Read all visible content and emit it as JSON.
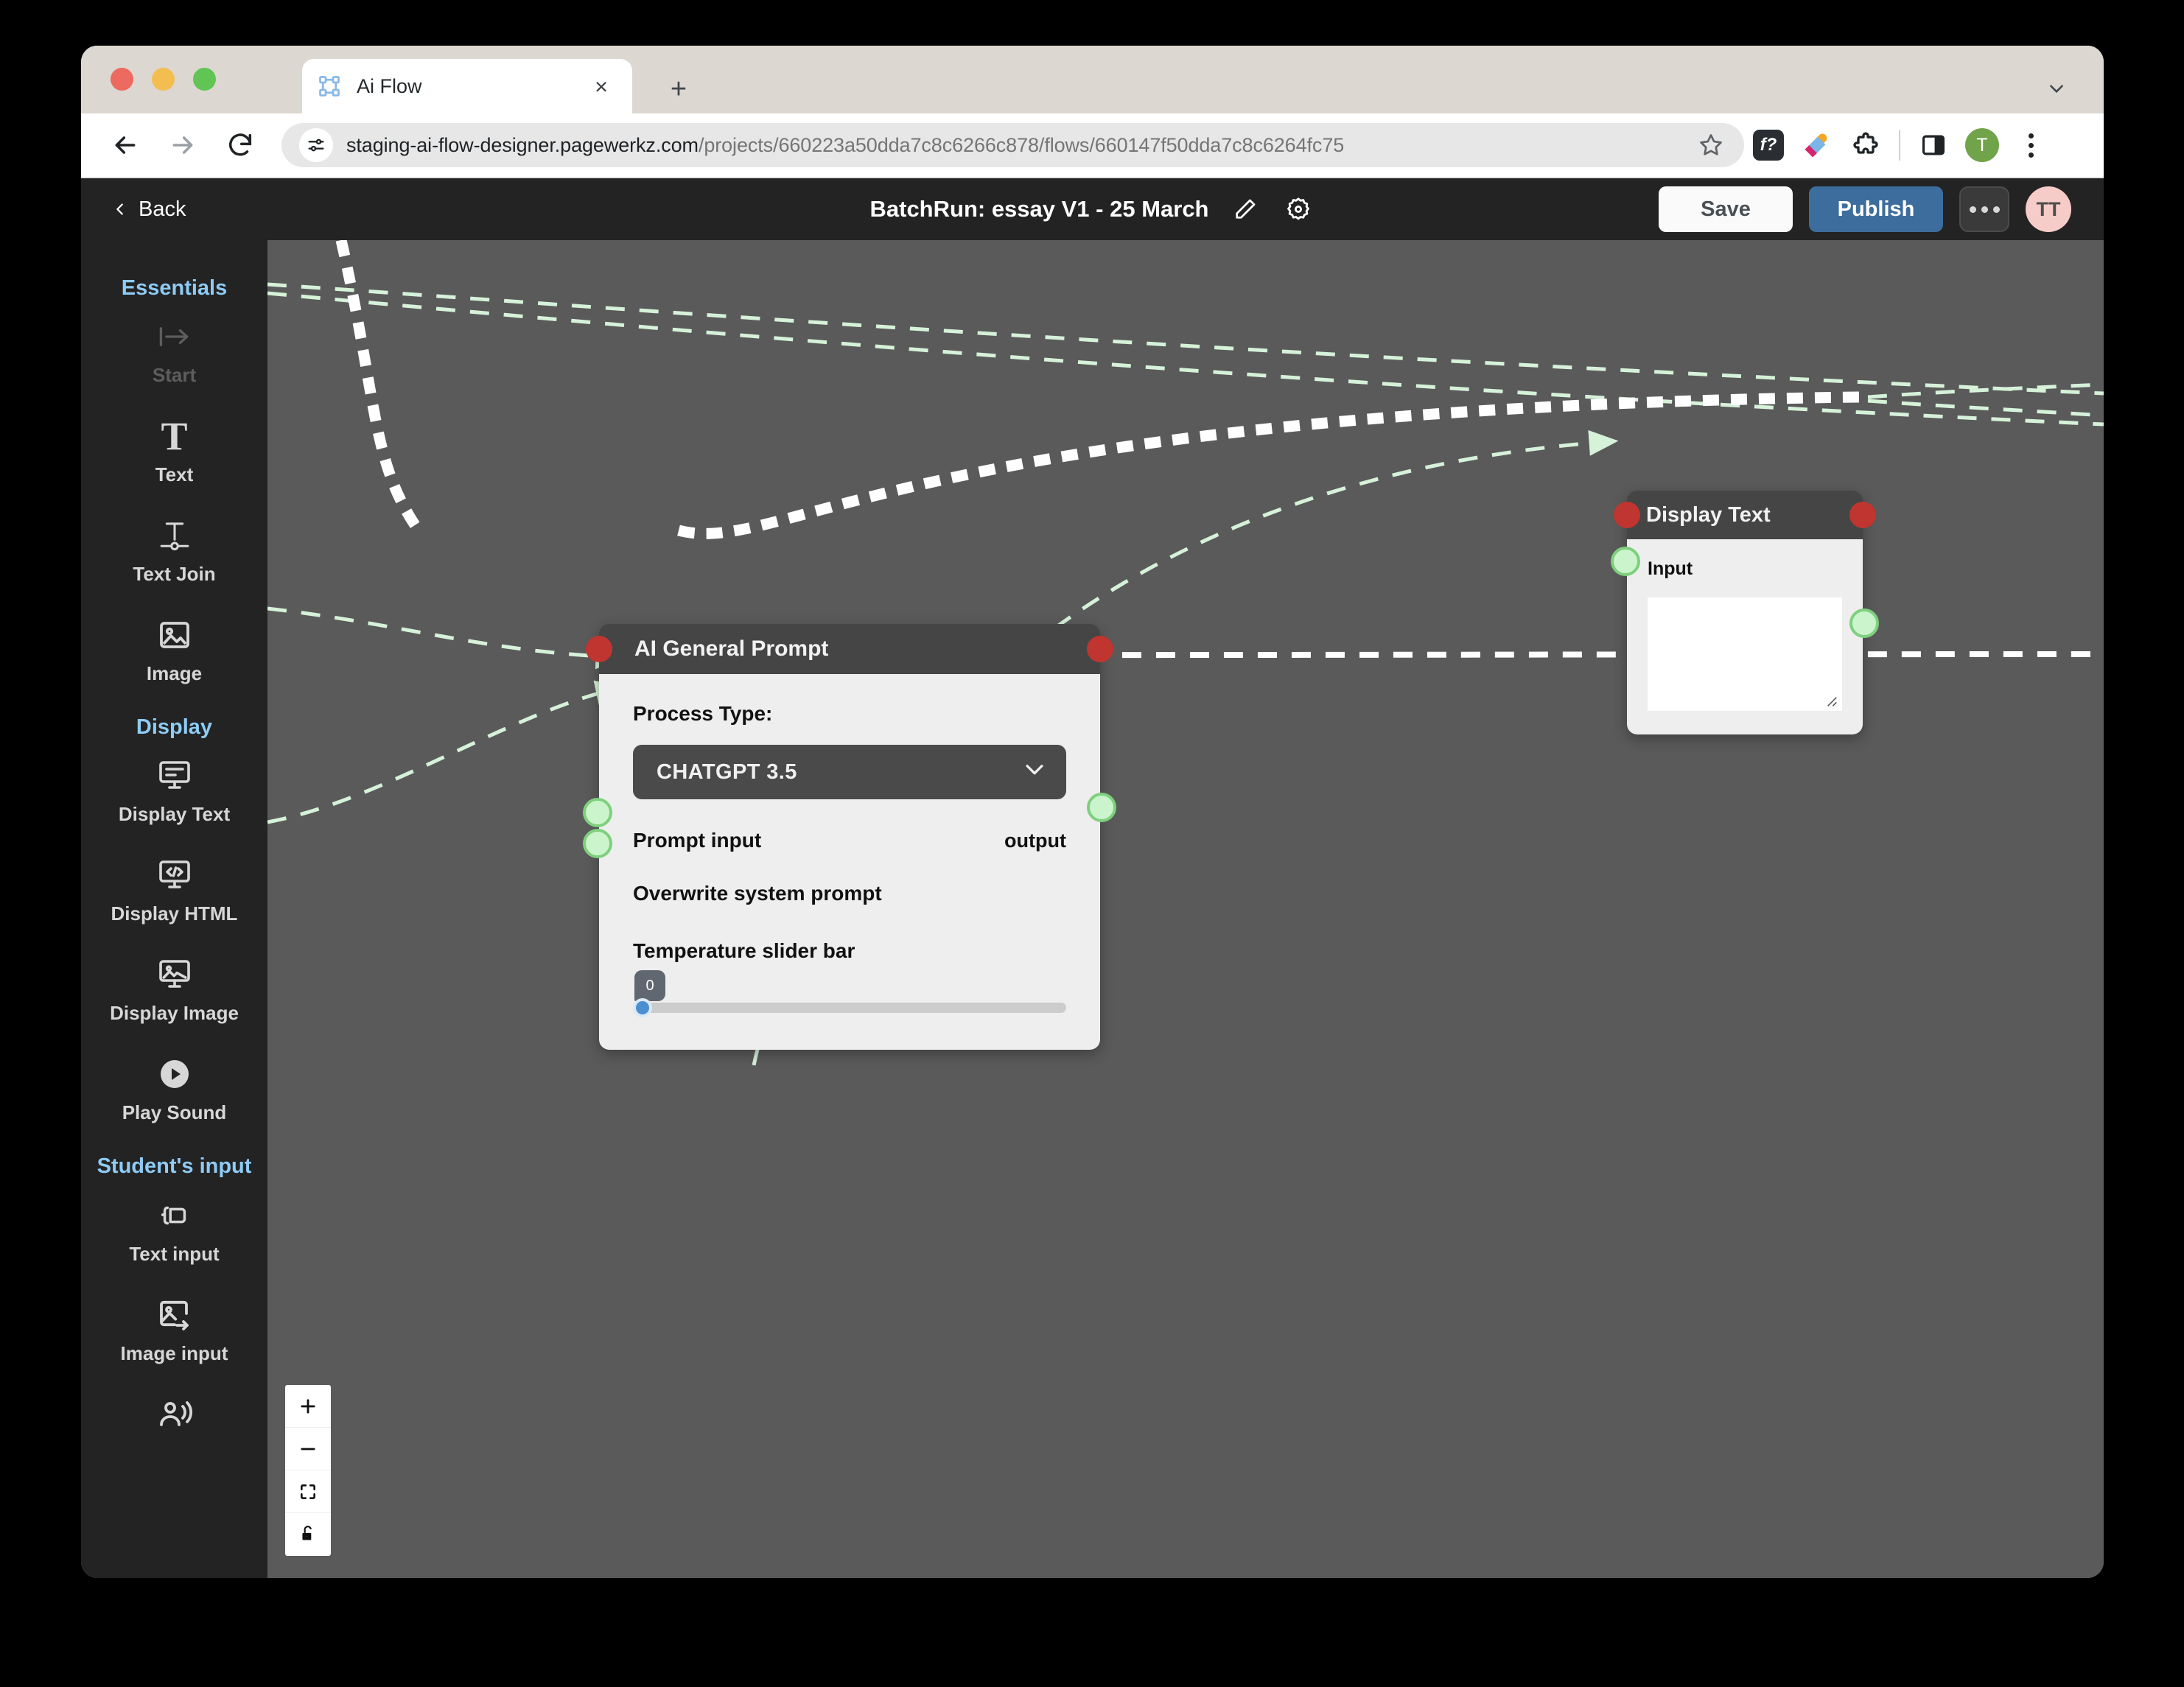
{
  "browser": {
    "tab": {
      "title": "Ai Flow",
      "favicon": "node-graph-icon",
      "close": "×"
    },
    "new_tab": "+",
    "url_host": "staging-ai-flow-designer.pagewerkz.com",
    "url_path": "/projects/660223a50dda7c8c6266c878/flows/660147f50dda7c8c6264fc75",
    "profile_initial": "T",
    "icons": [
      "bookmark-star-icon",
      "fq-extension-icon",
      "eyedropper-icon",
      "puzzle-extension-icon",
      "side-panel-icon",
      "profile-avatar",
      "browser-menu-icon"
    ],
    "ext_fq_label": "f?"
  },
  "app_header": {
    "back_label": "Back",
    "title": "BatchRun: essay V1 - 25 March",
    "edit_icon": "pencil-icon",
    "settings_icon": "gear-icon",
    "save_label": "Save",
    "publish_label": "Publish",
    "more_icon": "more-horizontal-icon",
    "user_initials": "TT",
    "accent_publish": "#3d6d9c",
    "accent_avatar": "#f6ccc8"
  },
  "sidebar": {
    "groups": [
      {
        "title": "Essentials",
        "items": [
          {
            "label": "Start",
            "icon": "start-arrow-icon",
            "disabled": true
          },
          {
            "label": "Text",
            "icon": "text-t-icon",
            "disabled": false
          },
          {
            "label": "Text Join",
            "icon": "text-join-icon",
            "disabled": false
          },
          {
            "label": "Image",
            "icon": "image-icon",
            "disabled": false
          }
        ]
      },
      {
        "title": "Display",
        "items": [
          {
            "label": "Display Text",
            "icon": "monitor-text-icon",
            "disabled": false
          },
          {
            "label": "Display HTML",
            "icon": "monitor-code-icon",
            "disabled": false
          },
          {
            "label": "Display Image",
            "icon": "monitor-image-icon",
            "disabled": false
          },
          {
            "label": "Play Sound",
            "icon": "play-sound-icon",
            "disabled": false
          }
        ]
      },
      {
        "title": "Student's input",
        "items": [
          {
            "label": "Text input",
            "icon": "text-input-icon",
            "disabled": false
          },
          {
            "label": "Image input",
            "icon": "image-input-icon",
            "disabled": false
          },
          {
            "label": "",
            "icon": "voice-input-icon",
            "disabled": false
          }
        ]
      }
    ],
    "group_title_color": "#8ecbf5"
  },
  "canvas": {
    "background": "#5a5a5a",
    "nodes": [
      {
        "id": "ai-general-prompt",
        "title": "AI General Prompt",
        "process_type_label": "Process Type:",
        "process_type_value": "CHATGPT 3.5",
        "chevron": "chevron-down-icon",
        "prompt_input_label": "Prompt input",
        "overwrite_label": "Overwrite system prompt",
        "output_label": "output",
        "temperature_label": "Temperature slider bar",
        "temperature_value": "0"
      },
      {
        "id": "display-text",
        "title": "Display Text",
        "input_label": "Input",
        "textarea_value": ""
      }
    ],
    "handle_colors": {
      "target": "#c0352f",
      "source": "#ccf4cc",
      "source_border": "#7ed07e"
    },
    "edge_colors": {
      "thick": "#ffffff",
      "thin": "#d6f2d9"
    }
  },
  "zoom_controls": {
    "buttons": [
      {
        "name": "zoom-in",
        "glyph": "+"
      },
      {
        "name": "zoom-out",
        "glyph": "−"
      },
      {
        "name": "fit-view",
        "glyph": "fit-icon"
      },
      {
        "name": "lock",
        "glyph": "unlock-icon"
      }
    ]
  }
}
